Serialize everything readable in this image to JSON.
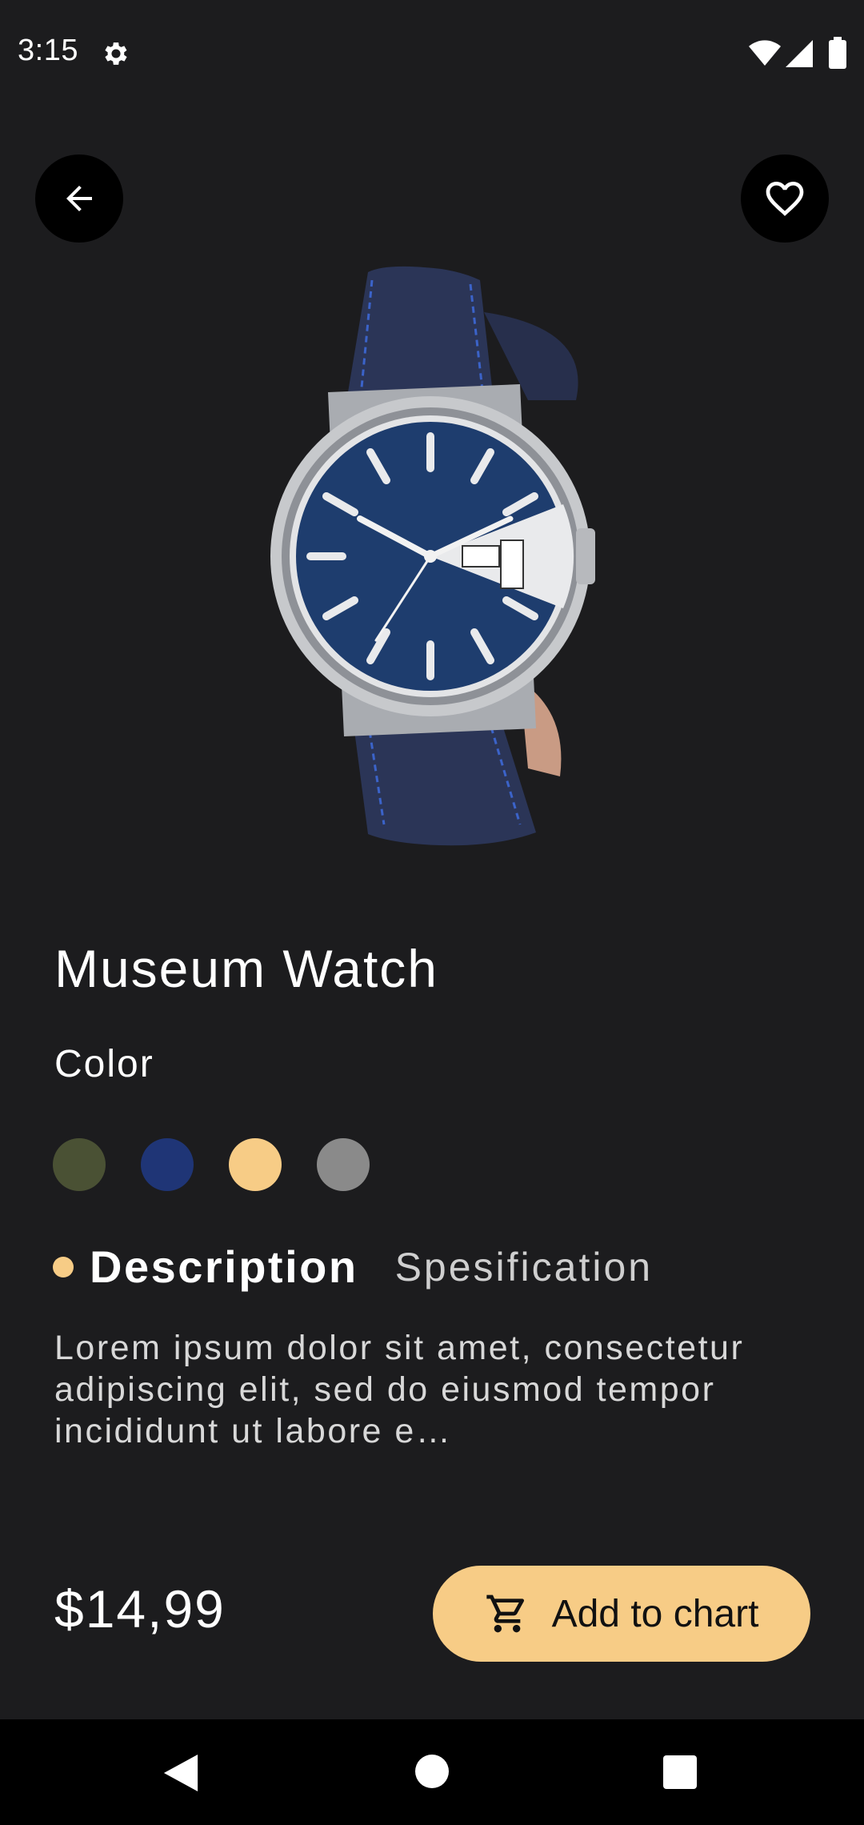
{
  "status_bar": {
    "time": "3:15",
    "icons": [
      "gear-icon",
      "wifi-icon",
      "signal-icon",
      "battery-icon"
    ]
  },
  "header": {
    "back_icon": "arrow-left-icon",
    "favorite_icon": "heart-outline-icon"
  },
  "product": {
    "image_icon": "wristwatch-image",
    "title": "Museum Watch",
    "color_label": "Color",
    "swatches": [
      {
        "name": "olive",
        "color": "#4a5134"
      },
      {
        "name": "navy",
        "color": "#1f3576"
      },
      {
        "name": "peach",
        "color": "#f7cc86"
      },
      {
        "name": "gray",
        "color": "#8a8a8a"
      }
    ],
    "tabs": {
      "active": "Description",
      "inactive": "Spesification",
      "dot_color": "#f7cc86"
    },
    "description": "Lorem ipsum dolor sit amet, consectetur adipiscing elit, sed do eiusmod tempor incididunt ut labore e…",
    "price": "$14,99",
    "cart_button": {
      "label": "Add to chart",
      "icon": "cart-icon",
      "color": "#f7cc86"
    }
  },
  "nav_bar": {
    "icons": [
      "nav-back-icon",
      "nav-home-icon",
      "nav-recents-icon"
    ]
  },
  "colors": {
    "background": "#1c1c1e",
    "accent": "#f7cc86"
  }
}
